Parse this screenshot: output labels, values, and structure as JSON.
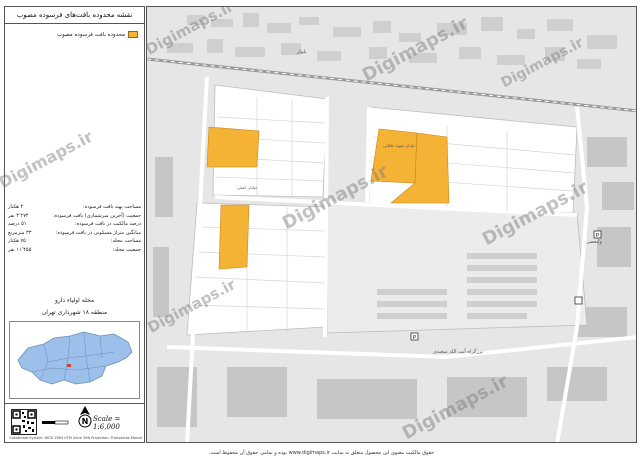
{
  "title": "نقشه محدوده بافت‌های فرسوده مصوب",
  "legend": {
    "label": "محدوده بافت فرسوده مصوب",
    "color": "#f5b335"
  },
  "stats": [
    {
      "label": "مساحت پهنه بافت فرسوده:",
      "value": "۴ هکتار"
    },
    {
      "label": "جمعیت (آخرین سرشماری) بافت فرسوده:",
      "value": "۴٬۲۷۴ نفر"
    },
    {
      "label": "درصد مالکیت در بافت فرسوده:",
      "value": "۵۱ درصد"
    },
    {
      "label": "میانگین متراژ مسکونی در بافت فرسوده:",
      "value": "۳۳ مترمربع"
    },
    {
      "label": "مساحت محله:",
      "value": "۷۵ هکتار"
    },
    {
      "label": "جمعیت محله:",
      "value": "۱۱٬۴۵۵ نفر"
    }
  ],
  "location": {
    "neighborhood": "محله اولیاء دارو",
    "district": "منطقه ۱۸ شهرداری تهران"
  },
  "scale": "Scale = 1:6,000",
  "credit": "Coordinate System: WGS 1984 UTM Zone 39N   Projection: Transverse Mercator",
  "footer": "حقوق مالکیت معنوی این محصول متعلق به سایت www.digimaps.ir بوده و تمامی حقوق آن محفوظ است.",
  "watermark": "Digimaps.ir",
  "map_labels": [
    "بزرگراه آیت الله سعیدی",
    "خیابان شهید خاقانی",
    "خیابان اصلی",
    "ولیعصر",
    "بلوار"
  ],
  "colors": {
    "block": "#ffffff",
    "road": "#ffffff",
    "area": "#e6e6e6",
    "building": "#c9c9c9",
    "highlight": "#f5b335"
  }
}
